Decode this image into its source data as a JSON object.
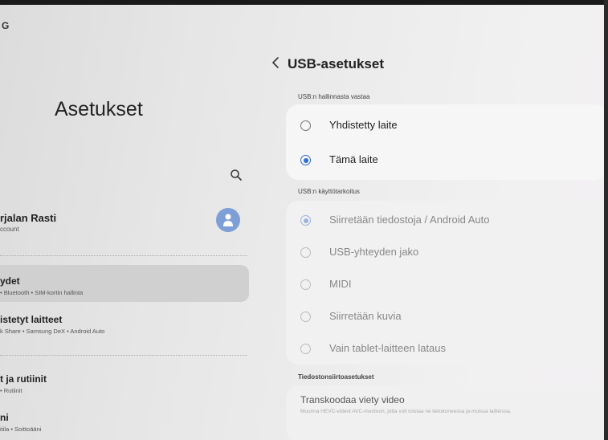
{
  "status_bar": {
    "text": "G"
  },
  "left_pane": {
    "title": "Asetukset",
    "profile": {
      "name": "rjalan Rasti",
      "sub": "ccount"
    },
    "items": [
      {
        "title": "ydet",
        "sub": "• Bluetooth • SIM-kortin hallinta"
      },
      {
        "title": "istetyt laitteet",
        "sub": "k Share • Samsung DeX • Android Auto"
      },
      {
        "title": "t ja rutiinit",
        "sub": "• Rutiinit"
      },
      {
        "title": "ni",
        "sub": "itila • Soittoääni"
      }
    ]
  },
  "right_pane": {
    "title": "USB-asetukset",
    "section_control": "USB:n hallinnasta vastaa",
    "control_options": [
      {
        "label": "Yhdistetty laite",
        "selected": false
      },
      {
        "label": "Tämä laite",
        "selected": true
      }
    ],
    "section_usage": "USB:n käyttötarkoitus",
    "usage_options": [
      {
        "label": "Siirretään tiedostoja / Android Auto",
        "selected": true
      },
      {
        "label": "USB-yhteyden jako",
        "selected": false
      },
      {
        "label": "MIDI",
        "selected": false
      },
      {
        "label": "Siirretään kuvia",
        "selected": false
      },
      {
        "label": "Vain tablet-laitteen lataus",
        "selected": false
      }
    ],
    "section_transfer": "Tiedostonsiirtoasetukset",
    "transfer": {
      "title": "Transkoodaa viety video",
      "desc": "Muunna HEVC-videot AVC-muotoon, jotta voit toistaa ne tietokoneessa ja muissa laitteissa."
    }
  },
  "colors": {
    "accent": "#2f6dd8",
    "avatar": "#7d9fd6"
  }
}
